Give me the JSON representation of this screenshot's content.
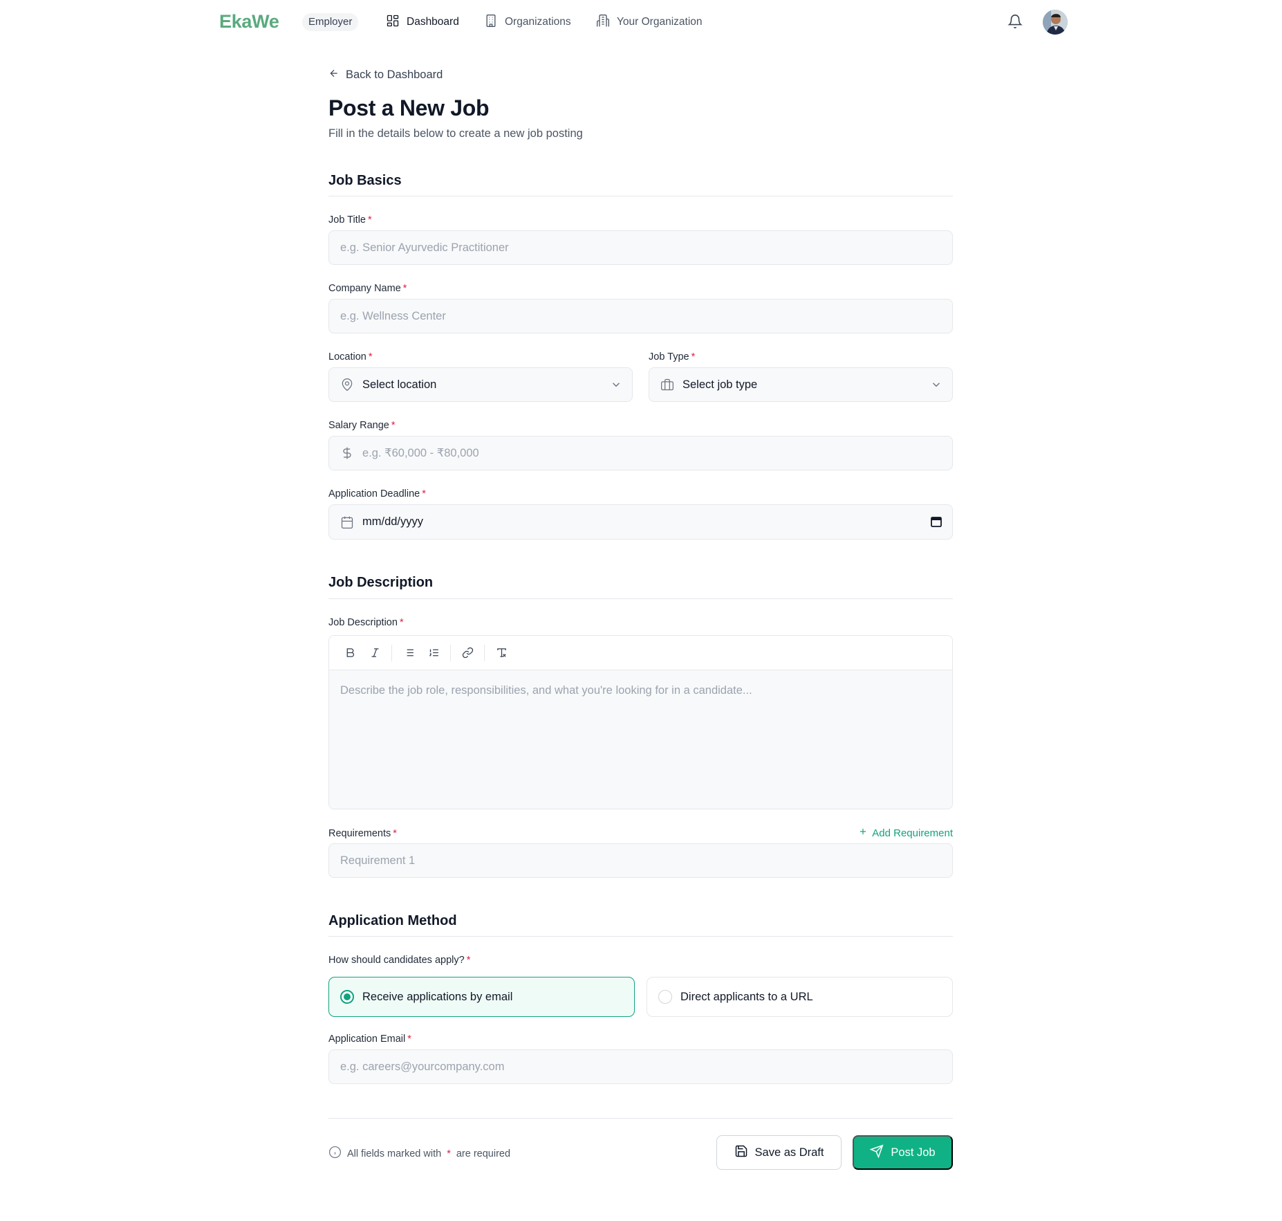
{
  "header": {
    "brand": "EkaWe",
    "role": "Employer",
    "nav": [
      {
        "label": "Dashboard",
        "icon": "dashboard-grid-icon",
        "active": true
      },
      {
        "label": "Organizations",
        "icon": "building-icon",
        "active": false
      },
      {
        "label": "Your Organization",
        "icon": "office-building-icon",
        "active": false
      }
    ]
  },
  "page": {
    "back_label": "Back to Dashboard",
    "title": "Post a New Job",
    "subtitle": "Fill in the details below to create a new job posting"
  },
  "job_basics": {
    "title": "Job Basics",
    "job_title": {
      "label": "Job Title",
      "placeholder": "e.g. Senior Ayurvedic Practitioner"
    },
    "company_name": {
      "label": "Company Name",
      "placeholder": "e.g. Wellness Center"
    },
    "location": {
      "label": "Location",
      "value": "Select location"
    },
    "job_type": {
      "label": "Job Type",
      "value": "Select job type"
    },
    "salary_range": {
      "label": "Salary Range",
      "placeholder": "e.g. ₹60,000 - ₹80,000"
    },
    "deadline": {
      "label": "Application Deadline",
      "value": "mm/dd/yyyy"
    }
  },
  "job_description": {
    "title": "Job Description",
    "description": {
      "label": "Job Description",
      "placeholder": "Describe the job role, responsibilities, and what you're looking for in a candidate..."
    },
    "toolbar": [
      "bold-icon",
      "italic-icon",
      "bullet-list-icon",
      "numbered-list-icon",
      "link-icon",
      "clear-format-icon"
    ],
    "requirements": {
      "label": "Requirements",
      "add_label": "Add Requirement",
      "items": [
        {
          "placeholder": "Requirement 1"
        }
      ]
    }
  },
  "application_method": {
    "title": "Application Method",
    "question": "How should candidates apply?",
    "options": [
      {
        "label": "Receive applications by email",
        "selected": true
      },
      {
        "label": "Direct applicants to a URL",
        "selected": false
      }
    ],
    "email": {
      "label": "Application Email",
      "placeholder": "e.g. careers@yourcompany.com"
    }
  },
  "footer": {
    "note_prefix": "All fields marked with",
    "note_star": "*",
    "note_suffix": "are required",
    "save_draft": "Save as Draft",
    "post_job": "Post Job"
  },
  "colors": {
    "brand": "#5aaa7e",
    "accent": "#10b285",
    "required": "#e11d48"
  }
}
